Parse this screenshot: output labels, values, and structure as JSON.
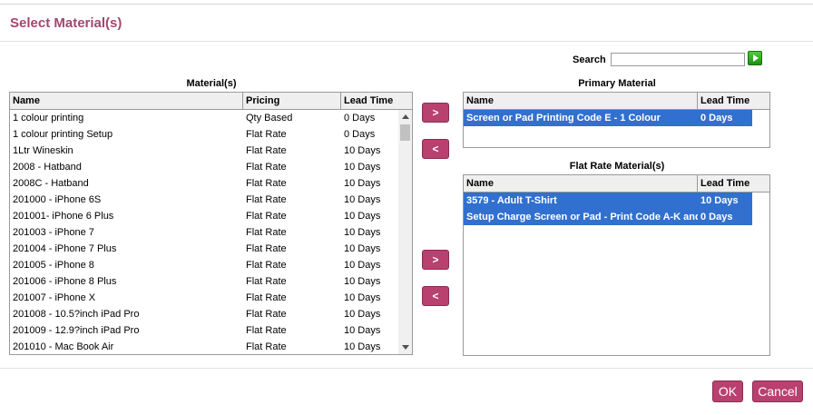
{
  "dialog": {
    "title": "Select Material(s)"
  },
  "search": {
    "label": "Search",
    "value": ""
  },
  "materials": {
    "caption": "Material(s)",
    "columns": [
      "Name",
      "Pricing",
      "Lead Time"
    ],
    "rows": [
      [
        "1 colour printing",
        "Qty Based",
        "0 Days"
      ],
      [
        "1 colour printing Setup",
        "Flat Rate",
        "0 Days"
      ],
      [
        "1Ltr Wineskin",
        "Flat Rate",
        "10 Days"
      ],
      [
        "2008 - Hatband",
        "Flat Rate",
        "10 Days"
      ],
      [
        "2008C - Hatband",
        "Flat Rate",
        "10 Days"
      ],
      [
        "201000 - iPhone 6S",
        "Flat Rate",
        "10 Days"
      ],
      [
        "201001- iPhone 6 Plus",
        "Flat Rate",
        "10 Days"
      ],
      [
        "201003 - iPhone 7",
        "Flat Rate",
        "10 Days"
      ],
      [
        "201004 - iPhone 7 Plus",
        "Flat Rate",
        "10 Days"
      ],
      [
        "201005 - iPhone 8",
        "Flat Rate",
        "10 Days"
      ],
      [
        "201006 - iPhone 8 Plus",
        "Flat Rate",
        "10 Days"
      ],
      [
        "201007 - iPhone X",
        "Flat Rate",
        "10 Days"
      ],
      [
        "201008 - 10.5?inch iPad Pro",
        "Flat Rate",
        "10 Days"
      ],
      [
        "201009 - 12.9?inch iPad Pro",
        "Flat Rate",
        "10 Days"
      ],
      [
        "201010 - Mac Book Air",
        "Flat Rate",
        "10 Days"
      ]
    ]
  },
  "primary": {
    "caption": "Primary Material",
    "columns": [
      "Name",
      "Lead Time"
    ],
    "rows": [
      [
        "Screen or Pad Printing Code E - 1 Colour",
        "0 Days"
      ]
    ]
  },
  "flat_rate": {
    "caption": "Flat Rate Material(s)",
    "columns": [
      "Name",
      "Lead Time"
    ],
    "rows": [
      [
        "3579 - Adult T-Shirt",
        "10 Days"
      ],
      [
        "Setup Charge Screen or Pad - Print Code A-K and I",
        "0 Days"
      ]
    ]
  },
  "move_buttons": {
    "add": ">",
    "remove": "<"
  },
  "footer": {
    "ok": "OK",
    "cancel": "Cancel"
  },
  "colors": {
    "accent": "#b9416f",
    "title": "#a6456f",
    "selection": "#3170cf"
  }
}
